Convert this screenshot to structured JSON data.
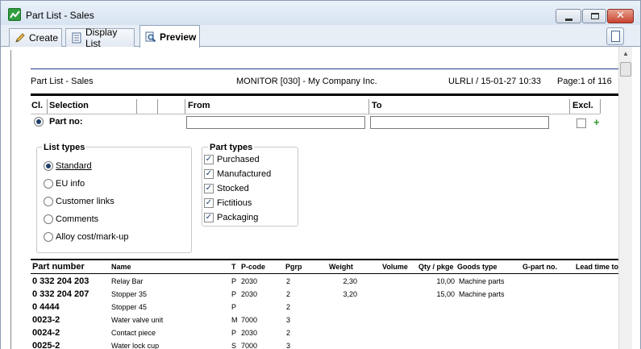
{
  "window": {
    "title": "Part List - Sales"
  },
  "tabs": [
    {
      "label": "Create",
      "icon": "pencil-icon"
    },
    {
      "label": "Display List",
      "icon": "list-icon"
    },
    {
      "label": "Preview",
      "icon": "magnifier-icon"
    }
  ],
  "report_header": {
    "title": "Part List - Sales",
    "company": "MONITOR [030] - My Company Inc.",
    "user_date": "ULRLI / 15-01-27 10:33",
    "page": "Page:1 of 116"
  },
  "selection": {
    "columns": {
      "cl": "Cl.",
      "selection": "Selection",
      "from": "From",
      "to": "To",
      "excl": "Excl."
    },
    "row_label": "Part no:",
    "from_value": "",
    "to_value": ""
  },
  "list_types": {
    "title": "List types",
    "options": [
      "Standard",
      "EU info",
      "Customer links",
      "Comments",
      "Alloy cost/mark-up"
    ],
    "selected": "Standard"
  },
  "part_types": {
    "title": "Part types",
    "options": [
      "Purchased",
      "Manufactured",
      "Stocked",
      "Fictitious",
      "Packaging"
    ]
  },
  "table": {
    "headers": {
      "part_number": "Part number",
      "name": "Name",
      "t": "T",
      "pcode": "P-code",
      "pgrp": "Pgrp",
      "weight": "Weight",
      "volume": "Volume",
      "qty": "Qty / pkge",
      "goods_type": "Goods type",
      "gpart": "G-part no.",
      "lead": "Lead time to"
    },
    "rows": [
      {
        "part_number": "0 332 204 203",
        "name": "Relay Bar",
        "t": "P",
        "pcode": "2030",
        "pgrp": "2",
        "weight": "2,30",
        "qty": "10,00",
        "goods_type": "Machine parts"
      },
      {
        "part_number": "0 332 204 207",
        "name": "Stopper 35",
        "t": "P",
        "pcode": "2030",
        "pgrp": "2",
        "weight": "3,20",
        "qty": "15,00",
        "goods_type": "Machine parts"
      },
      {
        "part_number": "0 4444",
        "name": "Stopper 45",
        "t": "P",
        "pcode": "",
        "pgrp": "2",
        "weight": "",
        "qty": "",
        "goods_type": ""
      },
      {
        "part_number": "0023-2",
        "name": "Water valve unit",
        "t": "M",
        "pcode": "7000",
        "pgrp": "3",
        "weight": "",
        "qty": "",
        "goods_type": ""
      },
      {
        "part_number": "0024-2",
        "name": "Contact piece",
        "t": "P",
        "pcode": "2030",
        "pgrp": "2",
        "weight": "",
        "qty": "",
        "goods_type": ""
      },
      {
        "part_number": "0025-2",
        "name": "Water lock cup",
        "t": "S",
        "pcode": "7000",
        "pgrp": "3",
        "weight": "",
        "qty": "",
        "goods_type": ""
      }
    ]
  }
}
